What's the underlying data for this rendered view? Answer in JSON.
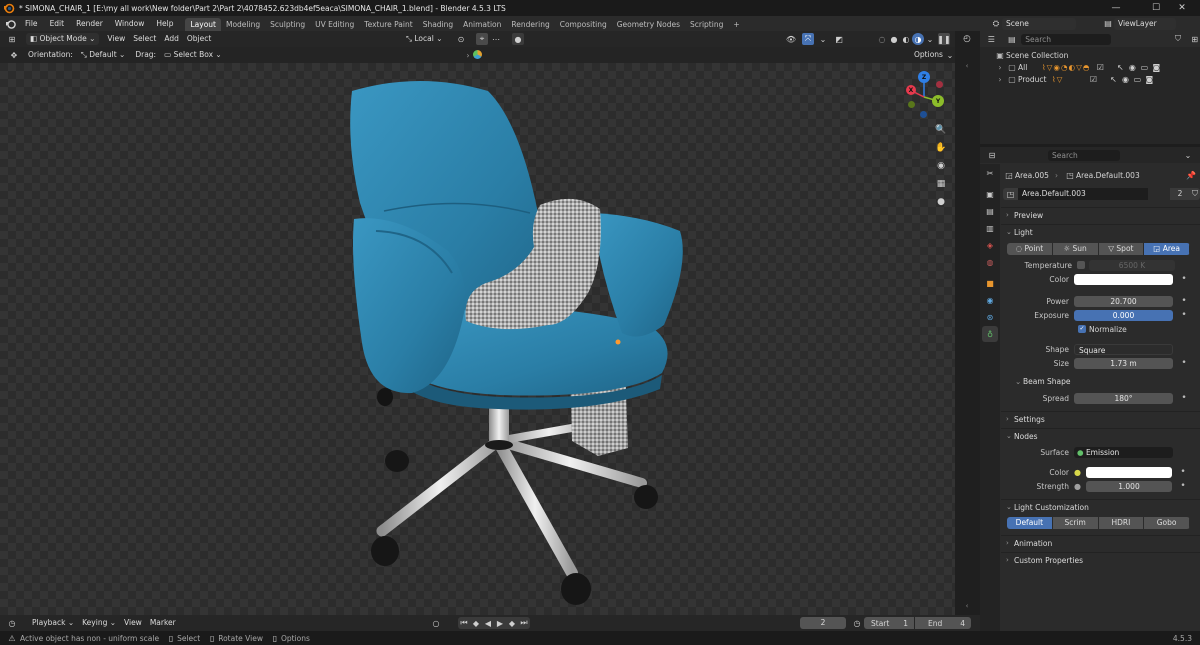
{
  "window": {
    "title": "* SIMONA_CHAIR_1 [E:\\my all work\\New folder\\Part 2\\Part 2\\4078452.623db4ef5eaca\\SIMONA_CHAIR_1.blend] - Blender 4.5.3 LTS",
    "minimize": "—",
    "maximize": "☐",
    "close": "✕"
  },
  "menu": [
    "File",
    "Edit",
    "Render",
    "Window",
    "Help"
  ],
  "workspaces": [
    "Layout",
    "Modeling",
    "Sculpting",
    "UV Editing",
    "Texture Paint",
    "Shading",
    "Animation",
    "Rendering",
    "Compositing",
    "Geometry Nodes",
    "Scripting"
  ],
  "workspace_add": "+",
  "scene": {
    "name": "Scene",
    "view_layer": "ViewLayer"
  },
  "viewport_header": {
    "mode": "Object Mode",
    "menus": [
      "View",
      "Select",
      "Add",
      "Object"
    ],
    "transform": "Local",
    "orientation_label": "Orientation:",
    "orientation_value": "Default",
    "drag_label": "Drag:",
    "drag_value": "Select Box",
    "options": "Options"
  },
  "gizmo": {
    "x": "X",
    "y": "Y",
    "z": "Z"
  },
  "outliner": {
    "search_placeholder": "Search",
    "collection": "Scene Collection",
    "items": [
      "All",
      "Product"
    ]
  },
  "properties": {
    "search_placeholder": "Search",
    "breadcrumb_object": "Area.005",
    "breadcrumb_data": "Area.Default.003",
    "datablock_name": "Area.Default.003",
    "datablock_users": "2",
    "panels": {
      "preview": "Preview",
      "light": "Light",
      "settings": "Settings",
      "nodes": "Nodes",
      "light_customization": "Light Customization",
      "animation": "Animation",
      "custom_properties": "Custom Properties"
    },
    "light_types": [
      "Point",
      "Sun",
      "Spot",
      "Area"
    ],
    "active_light_type": "Area",
    "temperature_label": "Temperature",
    "temperature_value": "6500 K",
    "color_label": "Color",
    "power_label": "Power",
    "power_value": "20.700",
    "exposure_label": "Exposure",
    "exposure_value": "0.000",
    "normalize_label": "Normalize",
    "shape_label": "Shape",
    "shape_value": "Square",
    "size_label": "Size",
    "size_value": "1.73 m",
    "beam_shape": "Beam Shape",
    "spread_label": "Spread",
    "spread_value": "180°",
    "surface_label": "Surface",
    "surface_value": "Emission",
    "node_color_label": "Color",
    "strength_label": "Strength",
    "strength_value": "1.000",
    "customization_options": [
      "Default",
      "Scrim",
      "HDRI",
      "Gobo"
    ],
    "active_customization": "Default"
  },
  "timeline": {
    "menus": [
      "Playback",
      "Keying",
      "View",
      "Marker"
    ],
    "current_frame": "2",
    "start_label": "Start",
    "start_value": "1",
    "end_label": "End",
    "end_value": "4"
  },
  "status": {
    "message": "Active object has non - uniform scale",
    "select": "Select",
    "rotate": "Rotate View",
    "options": "Options",
    "version": "4.5.3"
  },
  "colors": {
    "accent": "#4772b3",
    "chair": "#2b7fa6",
    "light_color": "#ffffff"
  }
}
